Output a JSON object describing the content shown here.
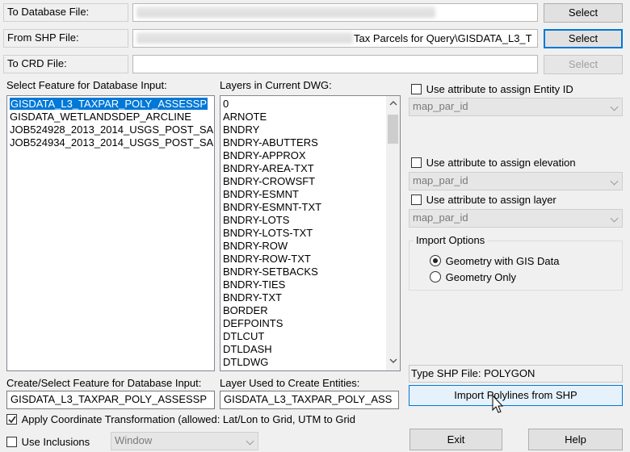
{
  "files": {
    "to_db_label": "To Database File:",
    "from_shp_label": "From SHP File:",
    "from_shp_value": "Tax Parcels for Query\\GISDATA_L3_T",
    "to_crd_label": "To CRD File:",
    "select_label": "Select"
  },
  "feature_select": {
    "label": "Select Feature for Database Input:",
    "items": [
      "GISDATA_L3_TAXPAR_POLY_ASSESSP",
      "GISDATA_WETLANDSDEP_ARCLINE",
      "JOB524928_2013_2014_USGS_POST_SA",
      "JOB524934_2013_2014_USGS_POST_SA"
    ]
  },
  "layers": {
    "label": "Layers in Current DWG:",
    "items": [
      "0",
      "ARNOTE",
      "BNDRY",
      "BNDRY-ABUTTERS",
      "BNDRY-APPROX",
      "BNDRY-AREA-TXT",
      "BNDRY-CROWSFT",
      "BNDRY-ESMNT",
      "BNDRY-ESMNT-TXT",
      "BNDRY-LOTS",
      "BNDRY-LOTS-TXT",
      "BNDRY-ROW",
      "BNDRY-ROW-TXT",
      "BNDRY-SETBACKS",
      "BNDRY-TIES",
      "BNDRY-TXT",
      "BORDER",
      "DEFPOINTS",
      "DTLCUT",
      "DTLDASH",
      "DTLDWG"
    ]
  },
  "attributes": {
    "entity_id_label": "Use attribute to assign Entity ID",
    "entity_id_value": "map_par_id",
    "elevation_label": "Use attribute to assign elevation",
    "elevation_value": "map_par_id",
    "layer_label": "Use attribute to assign layer",
    "layer_value": "map_par_id"
  },
  "import_options": {
    "title": "Import Options",
    "option1": "Geometry with GIS Data",
    "option2": "Geometry Only",
    "selected": "Geometry with GIS Data"
  },
  "shp_type": "Type SHP File: POLYGON",
  "import_button": "Import Polylines from SHP",
  "create_feature": {
    "label": "Create/Select Feature for Database Input:",
    "value": "GISDATA_L3_TAXPAR_POLY_ASSESSP"
  },
  "layer_used": {
    "label": "Layer Used to Create Entities:",
    "value": "GISDATA_L3_TAXPAR_POLY_ASS"
  },
  "coord_transform": {
    "label": "Apply Coordinate Transformation (allowed: Lat/Lon to Grid, UTM to Grid",
    "checked": true
  },
  "inclusions": {
    "label": "Use Inclusions",
    "combo_value": "Window"
  },
  "buttons": {
    "exit": "Exit",
    "help": "Help"
  }
}
